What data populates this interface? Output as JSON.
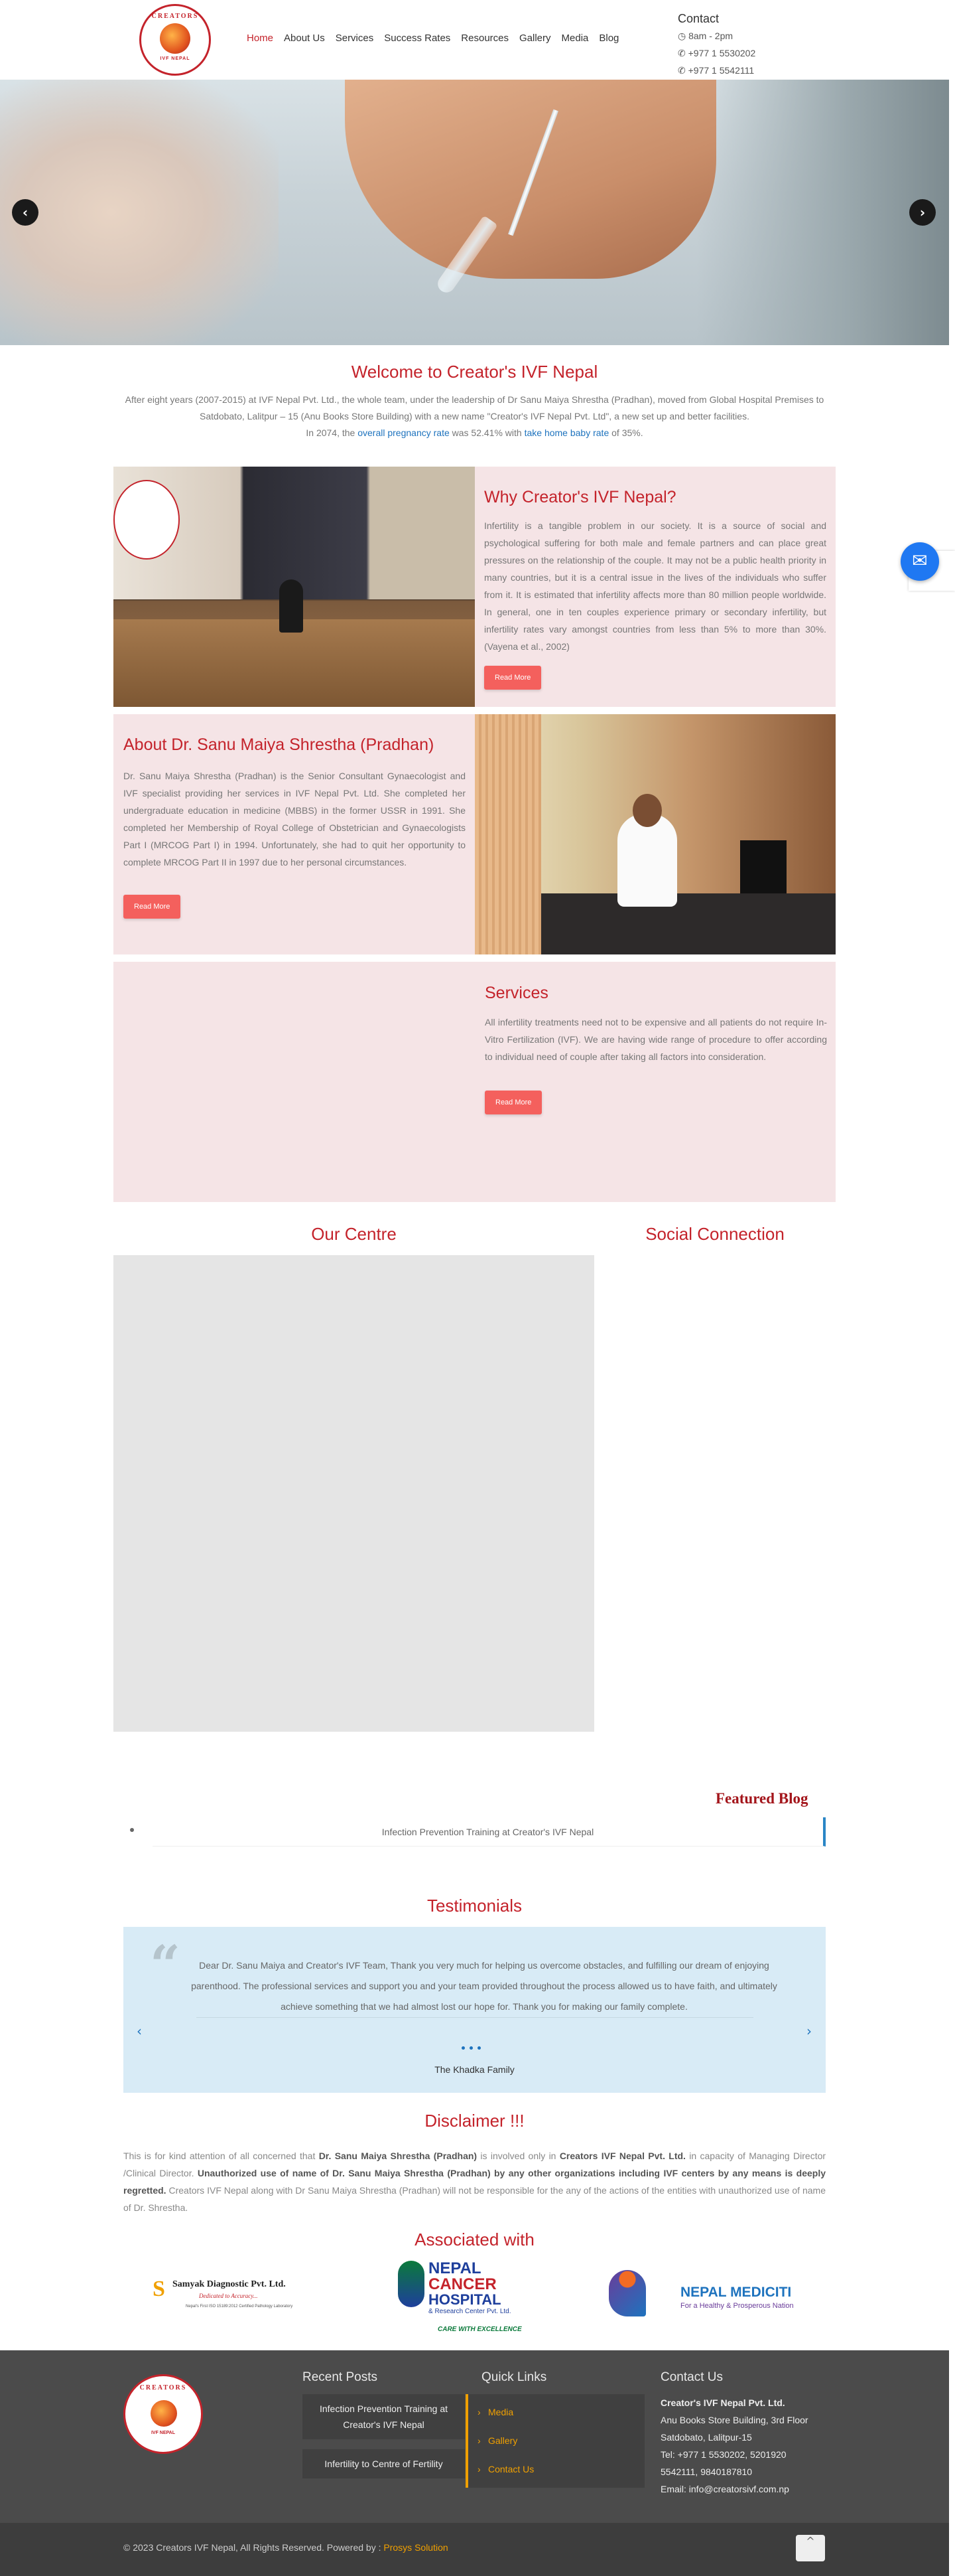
{
  "header": {
    "logo_text_top": "CREATORS",
    "logo_text_bottom": "IVF NEPAL",
    "nav": [
      "Home",
      "About Us",
      "Services",
      "Success Rates",
      "Resources",
      "Gallery",
      "Media",
      "Blog"
    ],
    "contact_title": "Contact",
    "hours": "8am - 2pm",
    "phone1": "+977 1 5530202",
    "phone2": "+977 1 5542111"
  },
  "hero": {
    "prev_icon": "chevron-left-icon",
    "next_icon": "chevron-right-icon"
  },
  "welcome": {
    "title": "Welcome to Creator's IVF Nepal",
    "text1": "After eight years (2007-2015) at IVF Nepal Pvt. Ltd., the whole team, under the leadership of Dr Sanu Maiya Shrestha (Pradhan), moved from Global Hospital Premises to Satdobato, Lalitpur – 15 (Anu Books Store Building) with a new name \"Creator's IVF Nepal Pvt. Ltd\", a new set up and better facilities.",
    "text2_prefix": "In 2074, the",
    "link1": "overall pregnancy rate",
    "text2_mid": "was 52.41% with",
    "link2": "take home baby rate",
    "text2_suffix": "of 35%."
  },
  "why": {
    "title": "Why Creator's IVF Nepal?",
    "text": "Infertility is a tangible problem in our society. It is a source of social and psychological suffering for both male and female partners and can place great pressures on the relationship of the couple. It may not be a public health priority in many countries, but it is a central issue in the lives of the individuals who suffer from it. It is estimated that infertility affects more than 80 million people worldwide. In general, one in ten couples experience primary or secondary infertility, but infertility rates vary amongst countries from less than 5% to more than 30%. (Vayena et al., 2002)",
    "button": "Read More"
  },
  "about": {
    "title": "About Dr. Sanu Maiya Shrestha (Pradhan)",
    "text": "Dr. Sanu Maiya Shrestha (Pradhan) is the Senior Consultant Gynaecologist and IVF specialist providing her services in IVF Nepal Pvt. Ltd. She completed her undergraduate education in medicine (MBBS) in the former USSR in 1991. She completed her Membership of Royal College of Obstetrician and Gynaecologists Part I (MRCOG Part I) in 1994. Unfortunately, she had to quit her opportunity to complete MRCOG Part II in 1997 due to her personal circumstances.",
    "button": "Read More"
  },
  "services": {
    "title": "Services",
    "text": "All infertility treatments need not to be expensive and all patients do not require In-Vitro Fertilization (IVF). We are having wide range of procedure to offer according to individual need of couple after taking all factors into consideration.",
    "button": "Read More"
  },
  "centre": {
    "title": "Our Centre"
  },
  "social": {
    "title": "Social Connection"
  },
  "blog": {
    "title": "Featured Blog",
    "item": "Infection Prevention Training at Creator's IVF Nepal"
  },
  "testimonials": {
    "title": "Testimonials",
    "quote": "Dear Dr. Sanu Maiya and Creator's IVF Team, Thank you very much for helping us overcome obstacles, and fulfilling our dream of enjoying parenthood. The professional services and support you and your team provided throughout the process allowed us to have faith, and ultimately achieve something that we had almost lost our hope for. Thank you for making our family complete.",
    "author": "The Khadka Family"
  },
  "disclaimer": {
    "title": "Disclaimer !!!",
    "p1": "This is for kind attention of all concerned that",
    "b1": "Dr. Sanu Maiya Shrestha (Pradhan)",
    "p2": "is involved only in",
    "b2": "Creators IVF Nepal Pvt. Ltd.",
    "p3": "in capacity of Managing Director /Clinical Director.",
    "b3": "Unauthorized use of name of Dr. Sanu Maiya Shrestha (Pradhan) by any other organizations including IVF centers by any means is deeply regretted.",
    "p4": "Creators IVF Nepal along with Dr Sanu Maiya Shrestha (Pradhan) will not be responsible for the any of the actions of the entities with unauthorized use of name of Dr. Shrestha."
  },
  "associated": {
    "title": "Associated with",
    "samyak": "Samyak Diagnostic Pvt. Ltd.",
    "samyak_tag": "Dedicated to Accuracy...",
    "samyak_sub": "Nepal's First ISO 15189:2012 Certified Pathology Laboratory",
    "nepal": "NEPAL",
    "cancer": "CANCER",
    "hospital": "HOSPITAL",
    "research": "& Research Center Pvt. Ltd.",
    "care": "CARE WITH EXCELLENCE",
    "mediciti": "NEPAL MEDICITI",
    "mediciti_tag": "For a Healthy & Prosperous Nation"
  },
  "footer": {
    "recent_title": "Recent Posts",
    "post1": "Infection Prevention Training at Creator's IVF Nepal",
    "post2": "Infertility to Centre of Fertility",
    "quick_title": "Quick Links",
    "links": [
      "Media",
      "Gallery",
      "Contact Us"
    ],
    "contact_title": "Contact Us",
    "company": "Creator's IVF Nepal Pvt. Ltd.",
    "addr1": "Anu Books Store Building, 3rd Floor",
    "addr2": "Satdobato, Lalitpur-15",
    "tel": "Tel: +977 1 5530202, 5201920",
    "tel2": "5542111, 9840187810",
    "email": "Email: info@creatorsivf.com.np",
    "copyright": "© 2023 Creators IVF Nepal, All Rights Reserved. Powered by :",
    "powered": "Prosys Solution"
  },
  "colors": {
    "brand_red": "#c4232b",
    "pink_bg": "#f5e4e6",
    "button": "#f4605d",
    "footer_bg": "#4b4b4b",
    "link_orange": "#f0a000"
  }
}
